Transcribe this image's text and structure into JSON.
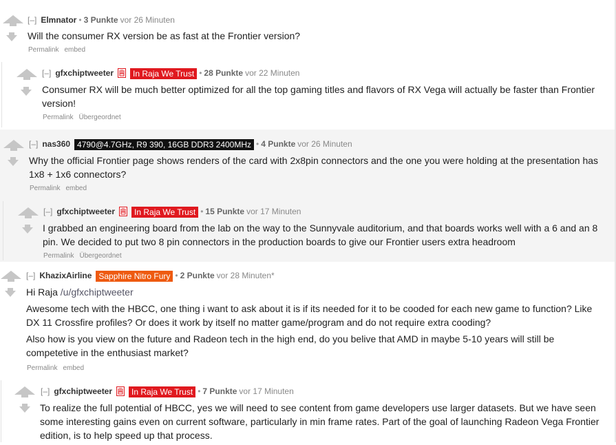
{
  "comments": [
    {
      "collapse": "[–]",
      "author": "Elmnator",
      "flair": "",
      "points": "3 Punkte",
      "time": "vor 26 Minuten",
      "body": [
        "Will the consumer RX version be as fast at the Frontier version?"
      ],
      "links": [
        "Permalink",
        "embed"
      ]
    },
    {
      "collapse": "[–]",
      "author": "gfxchiptweeter",
      "flair": "In Raja We Trust",
      "points": "28 Punkte",
      "time": "vor 22 Minuten",
      "body": [
        "Consumer RX will be much better optimized for all the top gaming titles and flavors of RX Vega will actually be faster than Frontier version!"
      ],
      "links": [
        "Permalink",
        "Übergeordnet"
      ]
    },
    {
      "collapse": "[–]",
      "author": "nas360",
      "flair": "4790@4.7GHz, R9 390, 16GB DDR3 2400MHz",
      "points": "4 Punkte",
      "time": "vor 26 Minuten",
      "body": [
        "Why the official Frontier page shows renders of the card with 2x8pin connectors and the one you were holding at the presentation has 1x8 + 1x6 connectors?"
      ],
      "links": [
        "Permalink",
        "embed"
      ]
    },
    {
      "collapse": "[–]",
      "author": "gfxchiptweeter",
      "flair": "In Raja We Trust",
      "points": "15 Punkte",
      "time": "vor 17 Minuten",
      "body": [
        "I grabbed an engineering board from the lab on the way to the Sunnyvale auditorium, and that boards works well with a 6 and an 8 pin. We decided to put two 8 pin connectors in the production boards to give our Frontier users extra headroom"
      ],
      "links": [
        "Permalink",
        "Übergeordnet"
      ]
    },
    {
      "collapse": "[–]",
      "author": "KhazixAirline",
      "flair": "Sapphire Nitro Fury",
      "points": "2 Punkte",
      "time": "vor 28 Minuten*",
      "greeting": "Hi Raja",
      "greeting_link": "/u/gfxchiptweeter",
      "body": [
        "Awesome tech with the HBCC, one thing i want to ask about it is if its needed for it to be cooded for each new game to function? Like DX 11 Crossfire profiles? Or does it work by itself no matter game/program and do not require extra cooding?",
        "Also how is you view on the future and Radeon tech in the high end, do you belive that AMD in maybe 5-10 years will still be competetive in the enthusiast market?"
      ],
      "links": [
        "Permalink",
        "embed"
      ]
    },
    {
      "collapse": "[–]",
      "author": "gfxchiptweeter",
      "flair": "In Raja We Trust",
      "points": "7 Punkte",
      "time": "vor 17 Minuten",
      "body": [
        "To realize the full potential of HBCC, yes we will need to see content from game developers use larger datasets. But we have seen some interesting gains even on current software, particularly in min frame rates. Part of the goal of launching Radeon Vega Frontier edition, is to help speed up that process."
      ],
      "links": []
    }
  ],
  "colors": {
    "flair_red": "#e0191f",
    "flair_black": "#111111",
    "flair_orange": "#ee5a10",
    "arrow": "#c6c6c6"
  }
}
